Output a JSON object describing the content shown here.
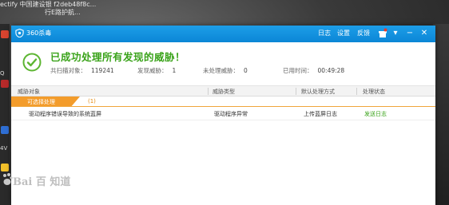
{
  "desktop": {
    "line1": "ectify   中国建设银   f2deb48f8c...",
    "line2": "行E路护航...",
    "left_label_1": "Q",
    "left_label_2": "4V"
  },
  "window": {
    "app_name": "360杀毒",
    "menu": {
      "log": "日志",
      "settings": "设置",
      "feedback": "反馈"
    },
    "buttons": {
      "minimize": "−",
      "close": "✕",
      "down": "▾"
    }
  },
  "summary": {
    "headline": "已成功处理所有发现的威胁！",
    "stats": [
      {
        "label": "共扫描对象：",
        "value": "119241"
      },
      {
        "label": "发现威胁：",
        "value": "1"
      },
      {
        "label": "未处理威胁：",
        "value": "0"
      },
      {
        "label": "已用时间：",
        "value": "00:49:28"
      }
    ]
  },
  "table": {
    "headers": [
      "威胁对象",
      "威胁类型",
      "默认处理方式",
      "处理状态"
    ],
    "group": {
      "label": "可选择处理",
      "count": "(1)"
    },
    "rows": [
      {
        "object": "驱动程序错误导致的系统蓝屏",
        "type": "驱动程序异常",
        "action": "上传蓝屏日志",
        "status": "发送日志"
      }
    ]
  },
  "watermark": {
    "text": "Bai 百 知道"
  },
  "colors": {
    "title_bar": "#0b86d6",
    "success": "#3aa31a",
    "group": "#f39c2b"
  }
}
